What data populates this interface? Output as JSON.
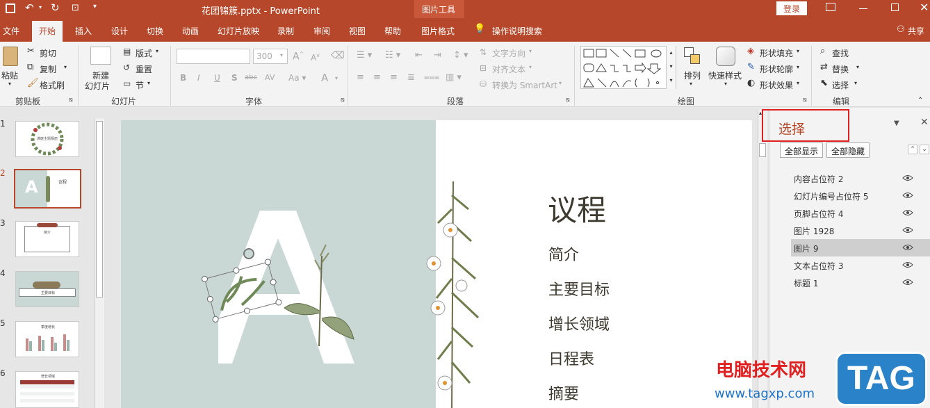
{
  "titlebar": {
    "file_name": "花团锦簇.pptx",
    "separator": "-",
    "app_name": "PowerPoint",
    "context_tool": "图片工具",
    "login_label": "登录"
  },
  "tabs": [
    {
      "label": "文件"
    },
    {
      "label": "开始"
    },
    {
      "label": "插入"
    },
    {
      "label": "设计"
    },
    {
      "label": "切换"
    },
    {
      "label": "动画"
    },
    {
      "label": "幻灯片放映"
    },
    {
      "label": "录制"
    },
    {
      "label": "审阅"
    },
    {
      "label": "视图"
    },
    {
      "label": "帮助"
    },
    {
      "label": "图片格式"
    }
  ],
  "tell_me": "操作说明搜索",
  "share": "共享",
  "ribbon": {
    "clipboard": {
      "paste": "粘贴",
      "cut": "剪切",
      "copy": "复制",
      "format_painter": "格式刷",
      "group": "剪贴板"
    },
    "slides": {
      "new_slide_line1": "新建",
      "new_slide_line2": "幻灯片",
      "layout": "版式",
      "reset": "重置",
      "section": "节",
      "group": "幻灯片"
    },
    "font": {
      "size_value": "300",
      "group": "字体"
    },
    "paragraph": {
      "text_direction": "文字方向",
      "align_text": "对齐文本",
      "convert_smartart": "转换为 SmartArt",
      "group": "段落"
    },
    "drawing": {
      "arrange": "排列",
      "quick_styles": "快速样式",
      "shape_fill": "形状填充",
      "shape_outline": "形状轮廓",
      "shape_effects": "形状效果",
      "group": "绘图"
    },
    "editing": {
      "find": "查找",
      "replace": "替换",
      "select": "选择",
      "group": "编辑"
    }
  },
  "thumbnails": [
    {
      "num": "1",
      "caption": "满庭主题相册"
    },
    {
      "num": "2",
      "caption": "议程"
    },
    {
      "num": "3",
      "caption": "简介"
    },
    {
      "num": "4",
      "caption": "主要目标"
    },
    {
      "num": "5",
      "caption": "季度增长"
    },
    {
      "num": "6",
      "caption": "增长领域"
    }
  ],
  "slide": {
    "big_letter": "A",
    "title": "议程",
    "items": [
      "简介",
      "主要目标",
      "增长领域",
      "日程表",
      "摘要"
    ]
  },
  "selection_pane": {
    "title": "选择",
    "show_all": "全部显示",
    "hide_all": "全部隐藏",
    "items": [
      "内容占位符 2",
      "幻灯片编号占位符 5",
      "页脚占位符 4",
      "图片 1928",
      "图片 9",
      "文本占位符 3",
      "标题 1"
    ],
    "selected_index": 4
  },
  "watermark": {
    "site_name": "电脑技术网",
    "url": "www.tagxp.com",
    "badge": "TAG"
  },
  "colors": {
    "accent": "#b7472a",
    "slide_left_bg": "#c9d8d5",
    "title_text": "#3e3a2f",
    "highlight_box": "#e02020"
  }
}
